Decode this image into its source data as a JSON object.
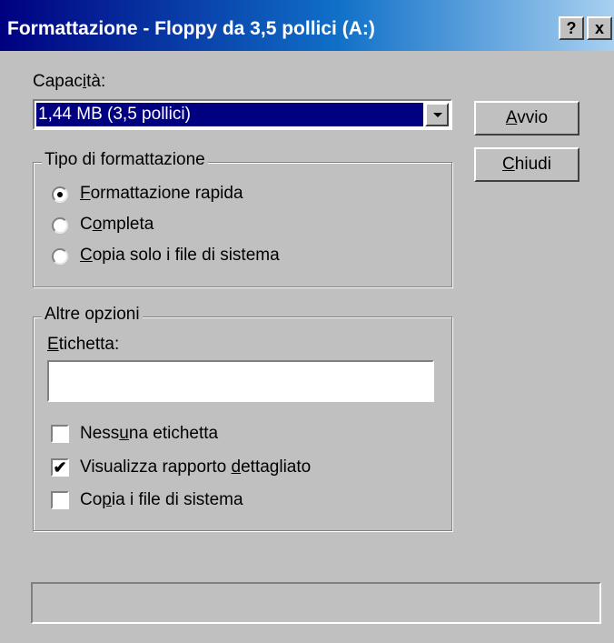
{
  "window": {
    "title": "Formattazione - Floppy da 3,5 pollici (A:)",
    "help_button": "?",
    "close_button": "x"
  },
  "capacity": {
    "label_pre": "Capac",
    "label_key": "i",
    "label_post": "tà:",
    "value": "1,44 MB (3,5 pollici)"
  },
  "buttons": {
    "start": {
      "key": "A",
      "rest": "vvio"
    },
    "close": {
      "key": "C",
      "rest": "hiudi"
    }
  },
  "format_type": {
    "legend": "Tipo di formattazione",
    "options": [
      {
        "pre": "",
        "key": "F",
        "post": "ormattazione rapida",
        "selected": true
      },
      {
        "pre": "C",
        "key": "o",
        "post": "mpleta",
        "selected": false
      },
      {
        "pre": "",
        "key": "C",
        "post": "opia solo i file di sistema",
        "selected": false
      }
    ]
  },
  "other_options": {
    "legend": "Altre opzioni",
    "label_field": {
      "key": "E",
      "rest": "tichetta:",
      "value": ""
    },
    "checkboxes": [
      {
        "pre": "Ness",
        "key": "u",
        "post": "na etichetta",
        "checked": false
      },
      {
        "pre": "Visualizza rapporto ",
        "key": "d",
        "post": "ettagliato",
        "checked": true
      },
      {
        "pre": "Co",
        "key": "p",
        "post": "ia i file di sistema",
        "checked": false
      }
    ]
  },
  "check_mark": "✔",
  "status_text": ""
}
